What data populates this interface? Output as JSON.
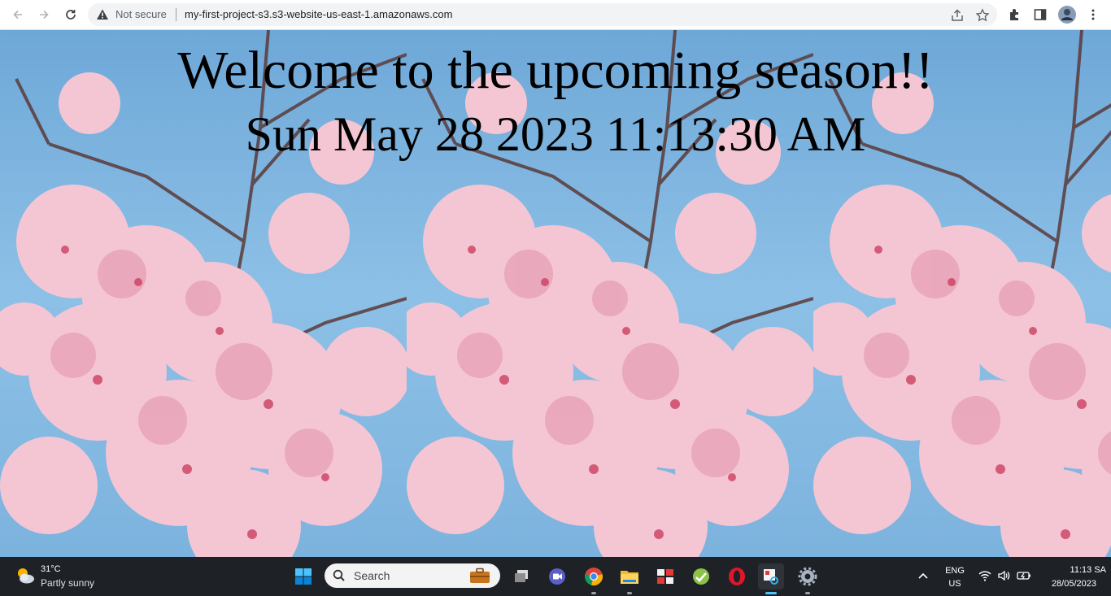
{
  "browser": {
    "security_label": "Not secure",
    "url": "my-first-project-s3.s3-website-us-east-1.amazonaws.com",
    "icons": [
      "back-icon",
      "forward-icon",
      "reload-icon",
      "warning-icon",
      "share-icon",
      "bookmark-star-icon",
      "extensions-icon",
      "side-panel-icon",
      "profile-avatar",
      "kebab-menu-icon"
    ]
  },
  "page": {
    "heading": "Welcome to the upcoming season!!",
    "datetime": "Sun May 28 2023 11:13:30 AM",
    "colors": {
      "sky": "#7fb4dd",
      "blossom": "#f4c6d4",
      "branch": "#5a3b3a"
    }
  },
  "taskbar": {
    "weather": {
      "temp": "31°C",
      "condition": "Partly sunny"
    },
    "search_label": "Search",
    "apps": [
      "windows-start",
      "search",
      "work-briefcase",
      "task-view",
      "meet",
      "chrome",
      "file-explorer",
      "app-tiles",
      "app-green",
      "opera",
      "snipping-tool",
      "settings"
    ],
    "tray": {
      "lang_top": "ENG",
      "lang_bottom": "US",
      "time": "11:13 SA",
      "date": "28/05/2023"
    }
  }
}
